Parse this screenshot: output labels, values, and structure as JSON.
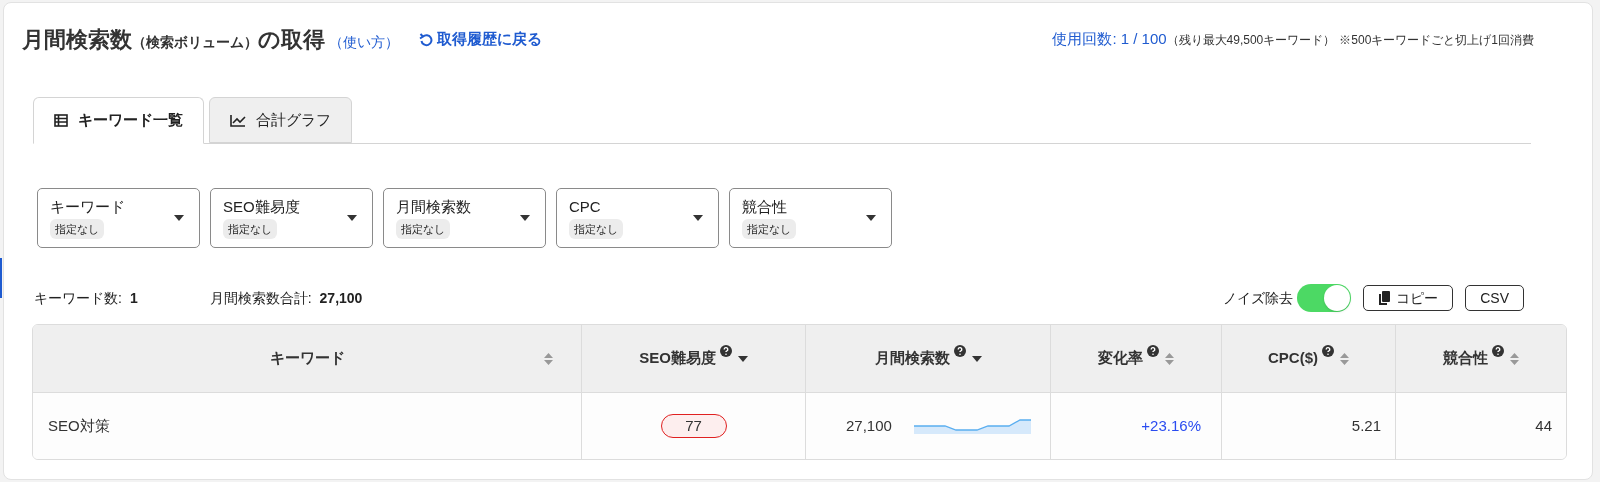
{
  "header": {
    "title": "月間検索数",
    "subtitle": "（検索ボリューム）",
    "title_end": "の取得",
    "help_link": "（使い方）",
    "back_link": "取得履歴に戻る",
    "usage": "使用回数: 1 / 100",
    "usage_note": "（残り最大49,500キーワード）",
    "usage_rule": "※500キーワードごと切上げ1回消費"
  },
  "tabs": [
    {
      "label": "キーワード一覧",
      "kind": "table",
      "selected": true
    },
    {
      "label": "合計グラフ",
      "kind": "chart",
      "selected": false
    }
  ],
  "filters": [
    {
      "label": "キーワード",
      "value": "指定なし"
    },
    {
      "label": "SEO難易度",
      "value": "指定なし"
    },
    {
      "label": "月間検索数",
      "value": "指定なし"
    },
    {
      "label": "CPC",
      "value": "指定なし"
    },
    {
      "label": "競合性",
      "value": "指定なし"
    }
  ],
  "stats": [
    {
      "label": "キーワード数:",
      "value": "1"
    },
    {
      "label": "月間検索数合計:",
      "value": "27,100"
    }
  ],
  "noise_filter": {
    "label": "ノイズ除去",
    "on": true
  },
  "actions": [
    {
      "label": "コピー",
      "kind": "copy"
    },
    {
      "label": "CSV",
      "kind": "plain"
    }
  ],
  "table": {
    "columns": [
      {
        "label": "キーワード",
        "help": false,
        "kind": "both"
      },
      {
        "label": "SEO難易度",
        "help": true,
        "kind": "desc"
      },
      {
        "label": "月間検索数",
        "help": true,
        "kind": "desc"
      },
      {
        "label": "変化率",
        "help": true,
        "kind": "both"
      },
      {
        "label": "CPC($)",
        "help": true,
        "kind": "both"
      },
      {
        "label": "競合性",
        "help": true,
        "kind": "both"
      }
    ],
    "rows": [
      {
        "keyword": "SEO対策",
        "difficulty": "77",
        "volume": "27,100",
        "change": "+23.16%",
        "cpc": "5.21",
        "competition": "44"
      }
    ]
  }
}
